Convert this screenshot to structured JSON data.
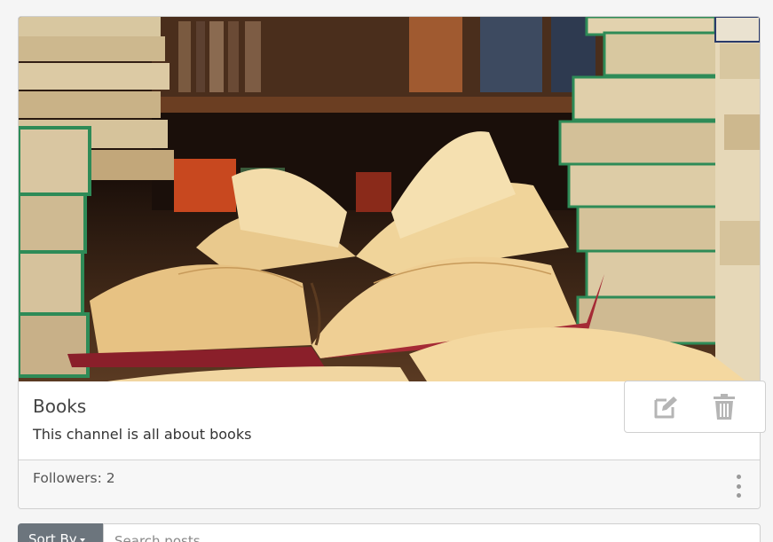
{
  "channel": {
    "title": "Books",
    "description": "This channel is all about books",
    "followers_text": "Followers: 2",
    "banner_alt": "books-photo"
  },
  "actions": {
    "edit_icon": "pencil-square-icon",
    "delete_icon": "trash-icon"
  },
  "toolbar": {
    "sort_label": "Sort By",
    "search_placeholder": "Search posts"
  },
  "colors": {
    "sort_button_bg": "#6c757d",
    "book_spine_green": "#2e8b57",
    "icon_gray": "#b5b5b5"
  }
}
